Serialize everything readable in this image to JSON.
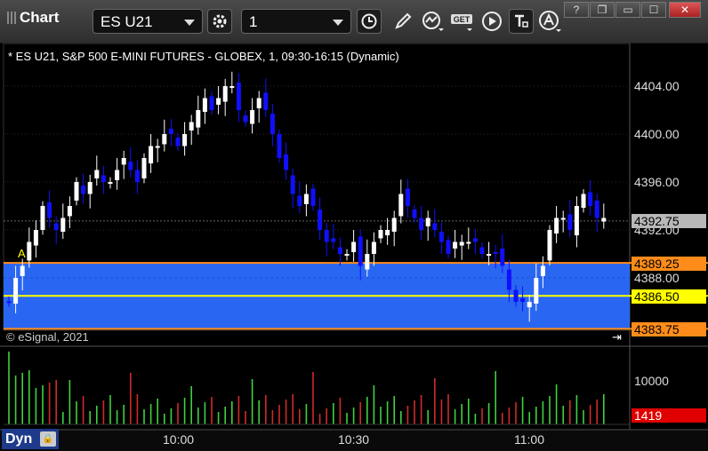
{
  "toolbar": {
    "title": "Chart",
    "symbol": "ES U21",
    "interval": "1",
    "buttons": [
      "settings-icon",
      "clock-icon",
      "pencil-icon",
      "study-icon",
      "get-icon",
      "play-icon",
      "text-icon",
      "alert-icon"
    ],
    "get_label": "GET"
  },
  "window": {
    "help": "?",
    "restore": "❐",
    "maximize": "☐",
    "close": "✕"
  },
  "chart": {
    "header": "* ES U21, S&P 500 E-MINI FUTURES - GLOBEX, 1, 09:30-16:15 (Dynamic)",
    "copyright": "© eSignal, 2021",
    "price_axis": [
      "4404.00",
      "4400.00",
      "4396.00",
      "4392.00",
      "4388.00"
    ],
    "volume_axis": [
      "10000"
    ],
    "time_axis": [
      "10:00",
      "10:30",
      "11:00"
    ],
    "tags": {
      "last": "4392.75",
      "zone_top": "4389.25",
      "yellow_line": "4386.50",
      "zone_bottom": "4383.75",
      "volume": "1419"
    },
    "marker": "A",
    "dynamic_label": "Dyn",
    "colors": {
      "up": "#ffffff",
      "down": "#1010ff",
      "zone": "#2b6cff",
      "zone_border": "#ff8c1a",
      "yellow": "#ffff00",
      "vol_up": "#3fd03f",
      "vol_down": "#d02a2a",
      "last_tag": "#b8b8b8",
      "zone_tag": "#ff8c1a",
      "yellow_tag": "#ffff00",
      "vol_tag": "#e00000"
    }
  },
  "chart_data": {
    "type": "candlestick",
    "y_range": [
      4382,
      4407
    ],
    "close": [
      4386,
      4388,
      4389,
      4391,
      4392,
      4394,
      4393,
      4392,
      4393,
      4394,
      4396,
      4395,
      4396,
      4397,
      4396,
      4396,
      4397,
      4398,
      4397,
      4396,
      4398,
      4399,
      4399,
      4400,
      4400,
      4399,
      4400,
      4401,
      4402,
      4403,
      4402,
      4403,
      4404,
      4404,
      4402,
      4401,
      4402,
      4403,
      4402,
      4400,
      4398,
      4397,
      4395,
      4394,
      4395,
      4394,
      4392,
      4391,
      4391,
      4390,
      4390,
      4391,
      4389,
      4390,
      4391,
      4392,
      4392,
      4393,
      4395,
      4394,
      4393,
      4392,
      4393,
      4392,
      4391,
      4390,
      4391,
      4391,
      4391,
      4391,
      4390,
      4390,
      4390,
      4389,
      4387,
      4386,
      4386,
      4386,
      4388,
      4389,
      4392,
      4393,
      4393,
      4392,
      4394,
      4395,
      4394,
      4393,
      4393
    ]
  }
}
